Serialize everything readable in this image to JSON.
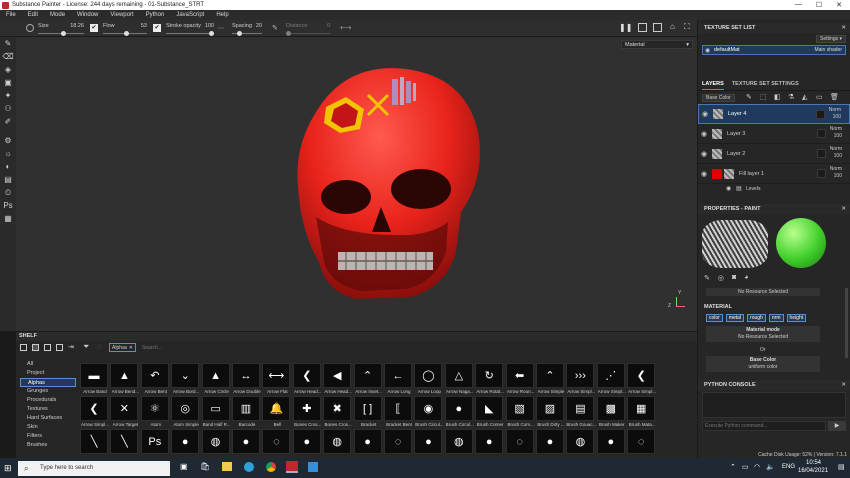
{
  "window": {
    "title": "Substance Painter - License: 244 days remaining - 01-Substance_STRT",
    "controls": [
      "—",
      "☐",
      "✕"
    ]
  },
  "menu": [
    "File",
    "Edit",
    "Mode",
    "Window",
    "Viewport",
    "Python",
    "JavaScript",
    "Help"
  ],
  "toolbar": {
    "size_label": "Size",
    "size_value": "18.26",
    "size_level": 0.55,
    "flow_label": "Flow",
    "flow_value": "53",
    "flow_level": 0.53,
    "stroke_opacity_label": "Stroke opacity",
    "stroke_opacity_value": "100",
    "stroke_opacity_level": 1.0,
    "spacing_label": "Spacing",
    "spacing_value": "20",
    "spacing_level": 0.2,
    "distance_label": "Distance",
    "distance_value": "0",
    "distance_level": 0.0
  },
  "viewport": {
    "material_select": "Material",
    "axis_y": "Y",
    "axis_z": "Z"
  },
  "texture_set_list": {
    "title": "TEXTURE SET LIST",
    "settings_label": "Settings ▾",
    "item_name": "defaultMat",
    "item_shader": "Main shader"
  },
  "layers_panel": {
    "tab_layers": "LAYERS",
    "tab_settings": "TEXTURE SET SETTINGS",
    "channel": "Base Color",
    "layers": [
      {
        "name": "Layer 4",
        "blend": "Norm",
        "opacity": "100",
        "selected": true,
        "fill": "#3a3a3a"
      },
      {
        "name": "Layer 3",
        "blend": "Norm",
        "opacity": "100",
        "selected": false,
        "fill": "#3a3a3a"
      },
      {
        "name": "Layer 2",
        "blend": "Norm",
        "opacity": "100",
        "selected": false,
        "fill": "#3a3a3a"
      },
      {
        "name": "Fill layer 1",
        "blend": "Norm",
        "opacity": "100",
        "selected": false,
        "fill": "#e00000"
      }
    ],
    "effect": "Levels"
  },
  "properties": {
    "title": "PROPERTIES - PAINT",
    "no_resource_1": "No Resource Selected",
    "material_section": "MATERIAL",
    "channels": [
      "color",
      "metal",
      "rough",
      "nrm",
      "height"
    ],
    "material_mode_label": "Material mode",
    "no_resource_2": "No Resource Selected",
    "or_label": "Or",
    "base_color_label": "Base Color",
    "base_color_value": "uniform color"
  },
  "python_console": {
    "title": "PYTHON CONSOLE",
    "placeholder": "Execute Python command..."
  },
  "status": {
    "cache": "Cache Disk Usage:",
    "cache_value": "52%",
    "version": "| Version: 7.1.1"
  },
  "shelf": {
    "title": "SHELF",
    "filter_tag": "Alphas",
    "search_placeholder": "Search...",
    "categories": [
      "All",
      "Project",
      "Alphas",
      "Grunges",
      "Procedurals",
      "Textures",
      "Hard Surfaces",
      "Skin",
      "Filters",
      "Brushes"
    ],
    "active_category": "Alphas",
    "assets_row1": [
      {
        "cap": "Arrow Band",
        "glyph": "▬"
      },
      {
        "cap": "Arrow Bend...",
        "glyph": "▲"
      },
      {
        "cap": "Arrow Bent",
        "glyph": "↶"
      },
      {
        "cap": "Arrow Bord...",
        "glyph": "⌄"
      },
      {
        "cap": "Arrow Circle",
        "glyph": "▲"
      },
      {
        "cap": "Arrow Double",
        "glyph": "↔"
      },
      {
        "cap": "Arrow Flat",
        "glyph": "⟷"
      },
      {
        "cap": "Arrow Head...",
        "glyph": "❮"
      },
      {
        "cap": "Arrow Head...",
        "glyph": "◀"
      },
      {
        "cap": "Arrow Inset...",
        "glyph": "⌃"
      },
      {
        "cap": "Arrow Long",
        "glyph": "←"
      },
      {
        "cap": "Arrow Loop",
        "glyph": "◯"
      },
      {
        "cap": "Arrow Naga...",
        "glyph": "△"
      },
      {
        "cap": "Arrow Rotat...",
        "glyph": "↻"
      },
      {
        "cap": "Arrow Roun...",
        "glyph": "⬅"
      },
      {
        "cap": "Arrow Simple",
        "glyph": "⌃"
      },
      {
        "cap": "Arrow Simpl...",
        "glyph": "›››"
      },
      {
        "cap": "Arrow Simpl...",
        "glyph": "⋰"
      },
      {
        "cap": "Arrow Simpl...",
        "glyph": "❮"
      }
    ],
    "assets_row2": [
      {
        "cap": "Arrow Simpl...",
        "glyph": "❮"
      },
      {
        "cap": "Arrow Target",
        "glyph": "✕"
      },
      {
        "cap": "Atom",
        "glyph": "⚛"
      },
      {
        "cap": "Atom Simple",
        "glyph": "◎"
      },
      {
        "cap": "Band Half R...",
        "glyph": "▭"
      },
      {
        "cap": "Barcode",
        "glyph": "▥"
      },
      {
        "cap": "Bell",
        "glyph": "🔔"
      },
      {
        "cap": "Bones Cros...",
        "glyph": "✚"
      },
      {
        "cap": "Bones Cros...",
        "glyph": "✖"
      },
      {
        "cap": "Bracket",
        "glyph": "[ ]"
      },
      {
        "cap": "Bracket Bent",
        "glyph": "⟦"
      },
      {
        "cap": "Brush Circul...",
        "glyph": "◉"
      },
      {
        "cap": "Brush Circul...",
        "glyph": "●"
      },
      {
        "cap": "Brush Corner",
        "glyph": "◣"
      },
      {
        "cap": "Brush Com...",
        "glyph": "▧"
      },
      {
        "cap": "Brush Dirty ...",
        "glyph": "▨"
      },
      {
        "cap": "Brush Gouac...",
        "glyph": "▤"
      },
      {
        "cap": "Brush Maker",
        "glyph": "▩"
      },
      {
        "cap": "Brush Mata...",
        "glyph": "▦"
      }
    ],
    "assets_row3": [
      {
        "glyph": "╲"
      },
      {
        "glyph": "╲"
      },
      {
        "glyph": "Ps"
      },
      {
        "glyph": "●"
      },
      {
        "glyph": "◍"
      },
      {
        "glyph": "●"
      },
      {
        "glyph": "◌"
      },
      {
        "glyph": "●"
      },
      {
        "glyph": "◍"
      },
      {
        "glyph": "●"
      },
      {
        "glyph": "◌"
      },
      {
        "glyph": "●"
      },
      {
        "glyph": "◍"
      },
      {
        "glyph": "●"
      },
      {
        "glyph": "◌"
      },
      {
        "glyph": "●"
      },
      {
        "glyph": "◍"
      },
      {
        "glyph": "●"
      },
      {
        "glyph": "◌"
      }
    ]
  },
  "taskbar": {
    "search_placeholder": "Type here to search",
    "lang": "ENG",
    "time": "10:54",
    "date": "16/04/2021"
  }
}
